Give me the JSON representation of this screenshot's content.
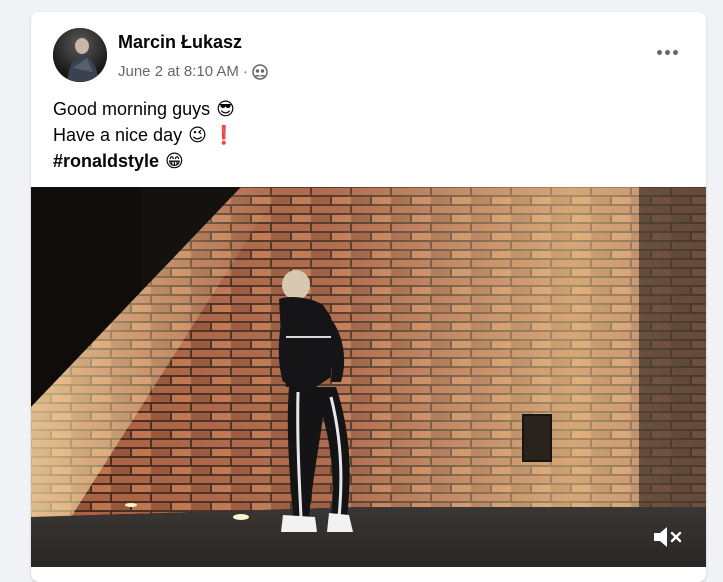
{
  "post": {
    "author": "Marcin Łukasz",
    "timestamp": "June 2 at 8:10 AM",
    "separator": "·",
    "privacy_icon": "friends-icon",
    "lines": [
      {
        "text": "Good morning guys",
        "emoji": "😎"
      },
      {
        "text": "Have a nice day",
        "emoji": "😉",
        "emoji2": "❗"
      },
      {
        "text": "#ronaldstyle",
        "emoji": "😁"
      }
    ]
  },
  "video": {
    "mute_icon": "muted-speaker-icon"
  },
  "colors": {
    "page_bg": "#f0f2f5",
    "card_bg": "#ffffff",
    "text_primary": "#050505",
    "text_secondary": "#65676b"
  }
}
